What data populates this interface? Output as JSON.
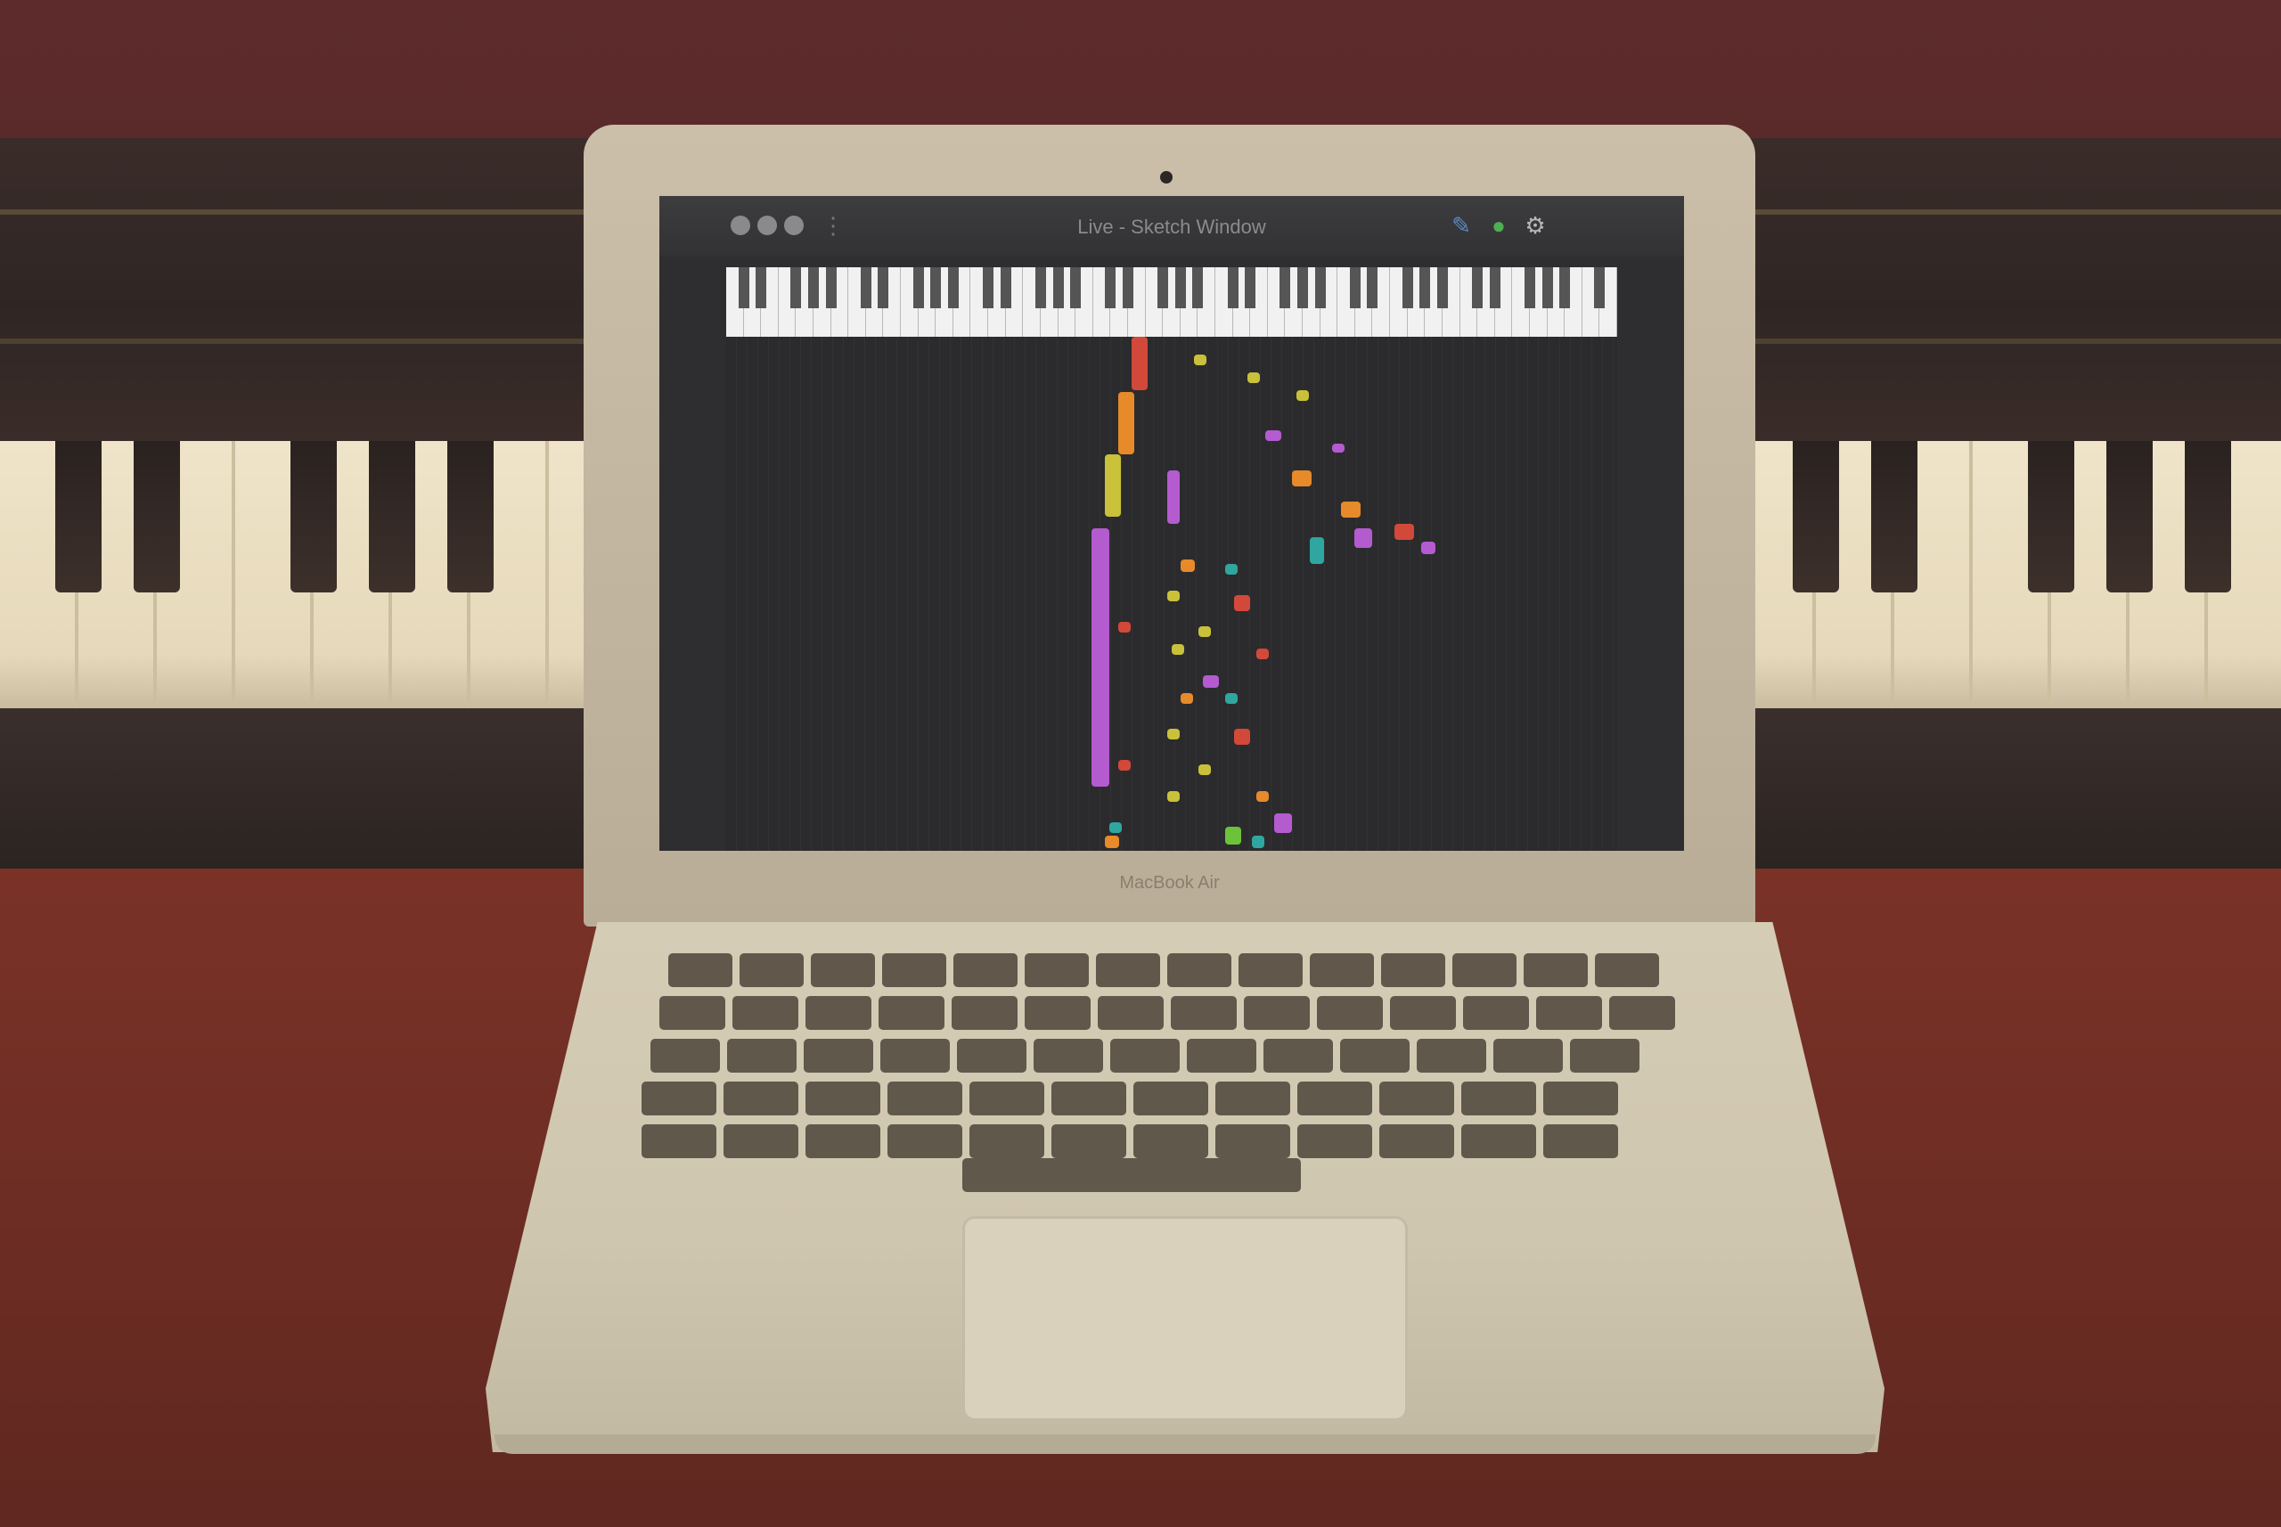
{
  "app": {
    "title": "Live - Sketch Window"
  },
  "toolbar": {
    "left_icons": [
      "traffic-close",
      "traffic-minimize",
      "traffic-zoom"
    ],
    "right_icons": [
      "share-icon",
      "record-icon",
      "settings-icon"
    ]
  },
  "laptop": {
    "brand": "MacBook Air"
  },
  "colors": {
    "accent_red": "#d2493a",
    "accent_orange": "#e68a2a",
    "accent_yellow": "#c9c13a",
    "accent_purple": "#b45bd0",
    "accent_teal": "#2fa7a0",
    "accent_green": "#6dc23a"
  }
}
